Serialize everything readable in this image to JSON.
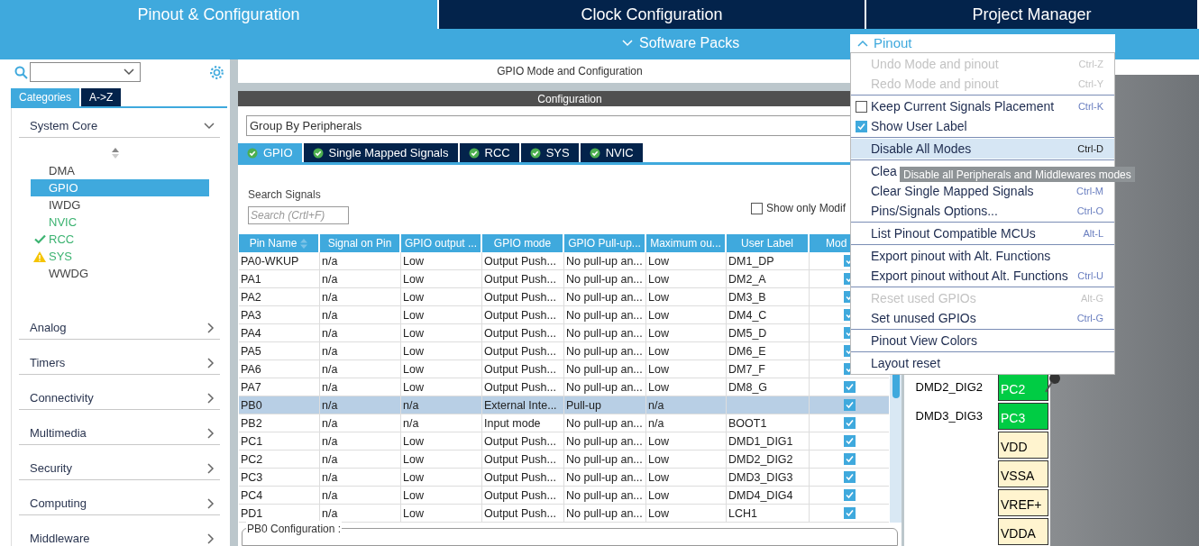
{
  "top_tabs": [
    {
      "label": "Pinout & Configuration",
      "selected": true
    },
    {
      "label": "Clock Configuration",
      "selected": false
    },
    {
      "label": "Project Manager",
      "selected": false
    }
  ],
  "sub_bar": {
    "software_packs": "Software Packs",
    "pinout_menu": "Pinout"
  },
  "sidebar": {
    "tabs": [
      {
        "label": "Categories",
        "selected": true
      },
      {
        "label": "A->Z",
        "selected": false
      }
    ],
    "categories": [
      {
        "label": "System Core",
        "expanded": true,
        "children": [
          {
            "label": "DMA",
            "selected": false,
            "kind": "plain"
          },
          {
            "label": "GPIO",
            "selected": true,
            "kind": "plain"
          },
          {
            "label": "IWDG",
            "selected": false,
            "kind": "plain"
          },
          {
            "label": "NVIC",
            "selected": false,
            "color": "#3cb371",
            "kind": "plain"
          },
          {
            "label": "RCC",
            "selected": false,
            "color": "#3cb371",
            "kind": "ok"
          },
          {
            "label": "SYS",
            "selected": false,
            "color": "#3cb371",
            "kind": "warning"
          },
          {
            "label": "WWDG",
            "selected": false,
            "kind": "plain"
          }
        ]
      },
      {
        "label": "Analog",
        "expanded": false
      },
      {
        "label": "Timers",
        "expanded": false
      },
      {
        "label": "Connectivity",
        "expanded": false
      },
      {
        "label": "Multimedia",
        "expanded": false
      },
      {
        "label": "Security",
        "expanded": false
      },
      {
        "label": "Computing",
        "expanded": false
      },
      {
        "label": "Middleware",
        "expanded": false
      }
    ]
  },
  "main": {
    "title": "GPIO Mode and Configuration",
    "config_bar": "Configuration",
    "group_by": "Group By Peripherals",
    "tabs": [
      {
        "label": "GPIO",
        "selected": true
      },
      {
        "label": "Single Mapped Signals",
        "selected": false
      },
      {
        "label": "RCC",
        "selected": false
      },
      {
        "label": "SYS",
        "selected": false
      },
      {
        "label": "NVIC",
        "selected": false
      }
    ],
    "search_label": "Search Signals",
    "search_placeholder": "Search (Crtl+F)",
    "show_only_modified": {
      "label": "Show only Modif",
      "checked": false
    },
    "table": {
      "columns": [
        "Pin Name",
        "Signal on Pin",
        "GPIO output ...",
        "GPIO mode",
        "GPIO Pull-up...",
        "Maximum ou...",
        "User Label",
        "Mod"
      ],
      "rows": [
        {
          "cells": [
            "PA0-WKUP",
            "n/a",
            "Low",
            "Output Push...",
            "No pull-up an...",
            "Low",
            "DM1_DP"
          ],
          "modified": true,
          "selected": false
        },
        {
          "cells": [
            "PA1",
            "n/a",
            "Low",
            "Output Push...",
            "No pull-up an...",
            "Low",
            "DM2_A"
          ],
          "modified": true,
          "selected": false
        },
        {
          "cells": [
            "PA2",
            "n/a",
            "Low",
            "Output Push...",
            "No pull-up an...",
            "Low",
            "DM3_B"
          ],
          "modified": true,
          "selected": false
        },
        {
          "cells": [
            "PA3",
            "n/a",
            "Low",
            "Output Push...",
            "No pull-up an...",
            "Low",
            "DM4_C"
          ],
          "modified": true,
          "selected": false
        },
        {
          "cells": [
            "PA4",
            "n/a",
            "Low",
            "Output Push...",
            "No pull-up an...",
            "Low",
            "DM5_D"
          ],
          "modified": true,
          "selected": false
        },
        {
          "cells": [
            "PA5",
            "n/a",
            "Low",
            "Output Push...",
            "No pull-up an...",
            "Low",
            "DM6_E"
          ],
          "modified": true,
          "selected": false
        },
        {
          "cells": [
            "PA6",
            "n/a",
            "Low",
            "Output Push...",
            "No pull-up an...",
            "Low",
            "DM7_F"
          ],
          "modified": true,
          "selected": false
        },
        {
          "cells": [
            "PA7",
            "n/a",
            "Low",
            "Output Push...",
            "No pull-up an...",
            "Low",
            "DM8_G"
          ],
          "modified": true,
          "selected": false
        },
        {
          "cells": [
            "PB0",
            "n/a",
            "n/a",
            "External Inte...",
            "Pull-up",
            "n/a",
            ""
          ],
          "modified": true,
          "selected": true
        },
        {
          "cells": [
            "PB2",
            "n/a",
            "n/a",
            "Input mode",
            "No pull-up an...",
            "n/a",
            "BOOT1"
          ],
          "modified": true,
          "selected": false
        },
        {
          "cells": [
            "PC1",
            "n/a",
            "Low",
            "Output Push...",
            "No pull-up an...",
            "Low",
            "DMD1_DIG1"
          ],
          "modified": true,
          "selected": false
        },
        {
          "cells": [
            "PC2",
            "n/a",
            "Low",
            "Output Push...",
            "No pull-up an...",
            "Low",
            "DMD2_DIG2"
          ],
          "modified": true,
          "selected": false
        },
        {
          "cells": [
            "PC3",
            "n/a",
            "Low",
            "Output Push...",
            "No pull-up an...",
            "Low",
            "DMD3_DIG3"
          ],
          "modified": true,
          "selected": false
        },
        {
          "cells": [
            "PC4",
            "n/a",
            "Low",
            "Output Push...",
            "No pull-up an...",
            "Low",
            "DMD4_DIG4"
          ],
          "modified": true,
          "selected": false
        },
        {
          "cells": [
            "PD1",
            "n/a",
            "Low",
            "Output Push...",
            "No pull-up an...",
            "Low",
            "LCH1"
          ],
          "modified": true,
          "selected": false
        }
      ]
    },
    "pin_config_title": "PB0 Configuration :"
  },
  "pinout": {
    "pins": [
      {
        "name": "PC2",
        "label": "DMD2_DIG2",
        "kind": "gpio"
      },
      {
        "name": "PC3",
        "label": "DMD3_DIG3",
        "kind": "gpio"
      },
      {
        "name": "VDD",
        "kind": "power"
      },
      {
        "name": "VSSA",
        "kind": "power"
      },
      {
        "name": "VREF+",
        "kind": "power"
      },
      {
        "name": "VDDA",
        "kind": "power"
      }
    ]
  },
  "menu": {
    "groups": [
      [
        {
          "label": "Undo Mode and pinout",
          "shortcut": "Ctrl-Z",
          "disabled": true
        },
        {
          "label": "Redo Mode and pinout",
          "shortcut": "Ctrl-Y",
          "disabled": true
        }
      ],
      [
        {
          "kind": "checkbox",
          "label": "Keep Current Signals Placement",
          "shortcut": "Ctrl-K",
          "checked": false
        },
        {
          "kind": "checkbox",
          "label": "Show User Label",
          "checked": true
        }
      ],
      [
        {
          "label": "Disable All Modes",
          "shortcut": "Ctrl-D",
          "selected": true
        }
      ],
      [
        {
          "label": "Clea"
        },
        {
          "label": "Clear Single Mapped Signals",
          "shortcut": "Ctrl-M"
        },
        {
          "label": "Pins/Signals Options...",
          "shortcut": "Ctrl-O"
        }
      ],
      [
        {
          "label": "List Pinout Compatible MCUs",
          "shortcut": "Alt-L"
        }
      ],
      [
        {
          "label": "Export pinout with Alt. Functions"
        },
        {
          "label": "Export pinout without Alt. Functions",
          "shortcut": "Ctrl-U"
        }
      ],
      [
        {
          "label": "Reset used GPIOs",
          "shortcut": "Alt-G",
          "disabled": true
        },
        {
          "label": "Set unused GPIOs",
          "shortcut": "Ctrl-G"
        }
      ],
      [
        {
          "label": "Pinout View Colors"
        }
      ],
      [
        {
          "label": "Layout reset"
        }
      ]
    ]
  },
  "tooltip": "Disable all Peripherals and Middlewares modes"
}
